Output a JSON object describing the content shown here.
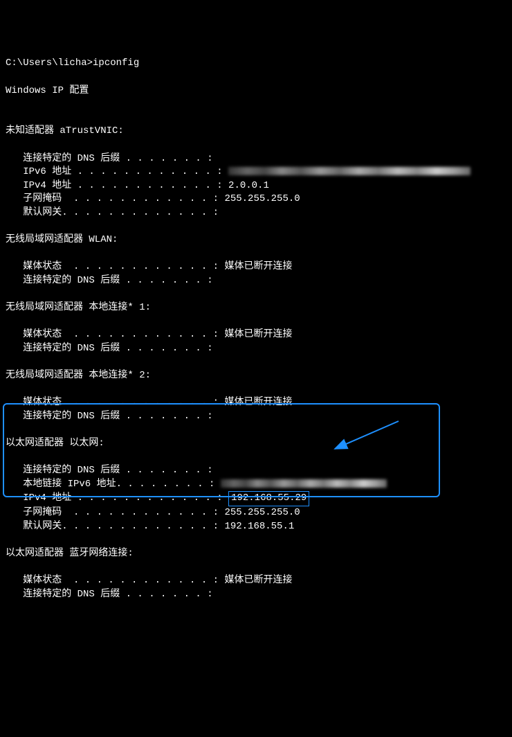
{
  "prompt": "C:\\Users\\licha>",
  "command": "ipconfig",
  "header": "Windows IP 配置",
  "adapters": [
    {
      "title": "未知适配器 aTrustVNIC:",
      "rows": [
        {
          "label": "   连接特定的 DNS 后缀 . . . . . . . :",
          "value": ""
        },
        {
          "label": "   IPv6 地址 . . . . . . . . . . . . :",
          "value": "",
          "blurred": true,
          "blurClass": "blurred-long"
        },
        {
          "label": "   IPv4 地址 . . . . . . . . . . . . :",
          "value": " 2.0.0.1"
        },
        {
          "label": "   子网掩码  . . . . . . . . . . . . :",
          "value": " 255.255.255.0"
        },
        {
          "label": "   默认网关. . . . . . . . . . . . . :",
          "value": ""
        }
      ]
    },
    {
      "title": "无线局域网适配器 WLAN:",
      "rows": [
        {
          "label": "   媒体状态  . . . . . . . . . . . . :",
          "value": " 媒体已断开连接"
        },
        {
          "label": "   连接特定的 DNS 后缀 . . . . . . . :",
          "value": ""
        }
      ]
    },
    {
      "title": "无线局域网适配器 本地连接* 1:",
      "rows": [
        {
          "label": "   媒体状态  . . . . . . . . . . . . :",
          "value": " 媒体已断开连接"
        },
        {
          "label": "   连接特定的 DNS 后缀 . . . . . . . :",
          "value": ""
        }
      ]
    },
    {
      "title": "无线局域网适配器 本地连接* 2:",
      "rows": [
        {
          "label": "   媒体状态  . . . . . . . . . . . . :",
          "value": " 媒体已断开连接"
        },
        {
          "label": "   连接特定的 DNS 后缀 . . . . . . . :",
          "value": ""
        }
      ]
    },
    {
      "title": "以太网适配器 以太网:",
      "highlighted": true,
      "rows": [
        {
          "label": "   连接特定的 DNS 后缀 . . . . . . . :",
          "value": ""
        },
        {
          "label": "   本地链接 IPv6 地址. . . . . . . . :",
          "value": "",
          "blurred": true,
          "blurClass": "blurred-med"
        },
        {
          "label": "   IPv4 地址 . . . . . . . . . . . . :",
          "value": "192.168.55.29",
          "ipHighlight": true
        },
        {
          "label": "   子网掩码  . . . . . . . . . . . . :",
          "value": " 255.255.255.0"
        },
        {
          "label": "   默认网关. . . . . . . . . . . . . :",
          "value": " 192.168.55.1"
        }
      ]
    },
    {
      "title": "以太网适配器 蓝牙网络连接:",
      "rows": [
        {
          "label": "   媒体状态  . . . . . . . . . . . . :",
          "value": " 媒体已断开连接"
        },
        {
          "label": "   连接特定的 DNS 后缀 . . . . . . . :",
          "value": ""
        }
      ]
    }
  ],
  "highlightedIp": "192.168.55.29"
}
